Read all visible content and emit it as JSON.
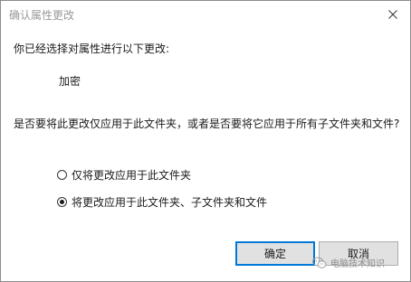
{
  "window": {
    "title": "确认属性更改"
  },
  "dialog": {
    "prompt": "你已经选择对属性进行以下更改:",
    "attribute_value": "加密",
    "question": "是否要将此更改仅应用于此文件夹，或者是否要将它应用于所有子文件夹和文件?",
    "options": [
      {
        "label": "仅将更改应用于此文件夹",
        "selected": false
      },
      {
        "label": "将更改应用于此文件夹、子文件夹和文件",
        "selected": true
      }
    ],
    "ok_label": "确定",
    "cancel_label": "取消"
  },
  "watermark": {
    "text": "电脑技术知识"
  },
  "colors": {
    "accent": "#0078d7",
    "button_face": "#e1e1e1",
    "title_text": "#999999"
  }
}
